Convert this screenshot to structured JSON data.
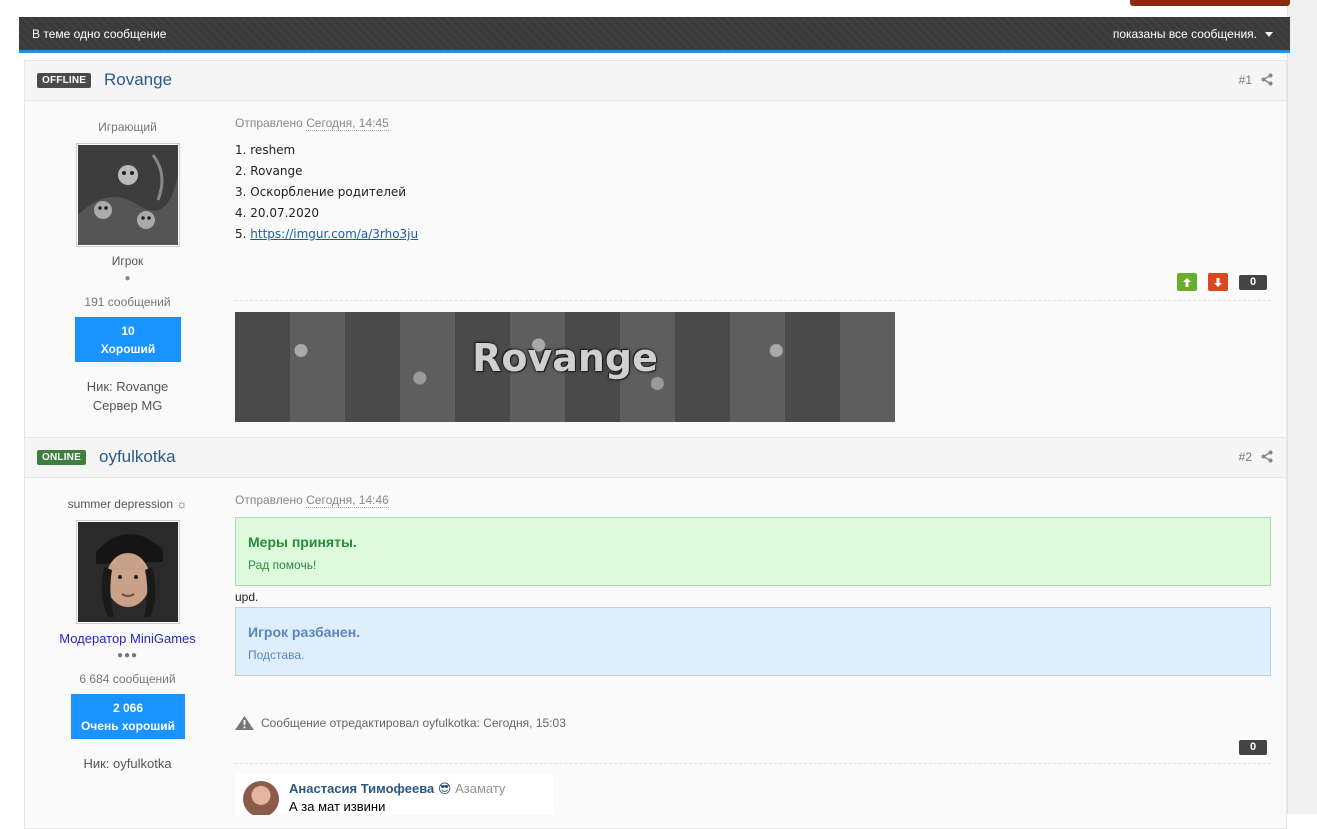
{
  "topic_bar": {
    "count_text": "В теме одно сообщение",
    "filter_text": "показаны все сообщения."
  },
  "posts": [
    {
      "status": "OFFLINE",
      "author": "Rovange",
      "number": "#1",
      "title": "Играющий",
      "group": "Игрок",
      "post_count": "191 сообщений",
      "rep_value": "10",
      "rep_label": "Хороший",
      "field1": "Ник: Rovange",
      "field2": "Сервер MG",
      "sent_prefix": "Отправлено",
      "sent_time": "Сегодня, 14:45",
      "list": [
        "1. reshem",
        "2. Rovange",
        "3. Оскорбление родителей",
        "4. 20.07.2020"
      ],
      "list_link_prefix": "5. ",
      "list_link": "https://imgur.com/a/3rho3ju",
      "reputation": "0",
      "signature_text": "Rovange"
    },
    {
      "status": "ONLINE",
      "author": "oyfulkotka",
      "number": "#2",
      "title": "summer depression ☼",
      "group": "Модератор MiniGames",
      "post_count": "6 684 сообщений",
      "rep_value": "2 066",
      "rep_label": "Очень хороший",
      "field1": "Ник: oyfulkotka",
      "sent_prefix": "Отправлено",
      "sent_time": "Сегодня, 14:46",
      "notice_green_title": "Меры приняты.",
      "notice_green_text": "Рад помочь!",
      "upd": "upd.",
      "notice_blue_title": "Игрок разбанен.",
      "notice_blue_text": "Подстава.",
      "edit_note": "Сообщение отредактировал oyfulkotka: Сегодня, 15:03",
      "reputation": "0",
      "vk_name": "Анастасия Тимофеева",
      "vk_emoji": "😎",
      "vk_to": "Азамату",
      "vk_message": "А за мат извини"
    }
  ],
  "colors": {
    "accent_blue": "#1893ff",
    "vote_up": "#6aad2a",
    "vote_down": "#d9481e",
    "offline_badge": "#4a4a4a",
    "online_badge": "#3e7e3e"
  }
}
